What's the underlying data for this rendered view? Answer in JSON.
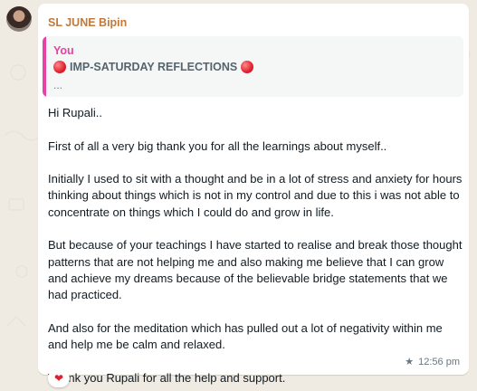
{
  "message": {
    "sender": "SL JUNE Bipin",
    "quote": {
      "author": "You",
      "title": "IMP-SATURDAY REFLECTIONS",
      "more": "..."
    },
    "paragraphs": [
      "Hi Rupali..",
      "First of all a very big thank you for all the learnings about myself..",
      "Initially I used to sit with a thought and be in a lot of stress and anxiety for hours thinking about things which is not in my control and due to this i was not able to concentrate on things which I could do and grow in life.",
      "But because of your teachings I have started to realise and break those thought patterns that are not helping me and also making me believe that I can grow and achieve my dreams because of the believable bridge statements that we had practiced.",
      "And also for the meditation which has pulled out a lot of negativity within me and help me be calm and relaxed.",
      "Thank you Rupali for all the help and support."
    ],
    "time": "12:56 pm",
    "starred_icon": "star-icon",
    "reaction": "❤"
  },
  "colors": {
    "sender": "#c2793a",
    "quote_accent": "#e542a3",
    "background": "#efeae2"
  }
}
